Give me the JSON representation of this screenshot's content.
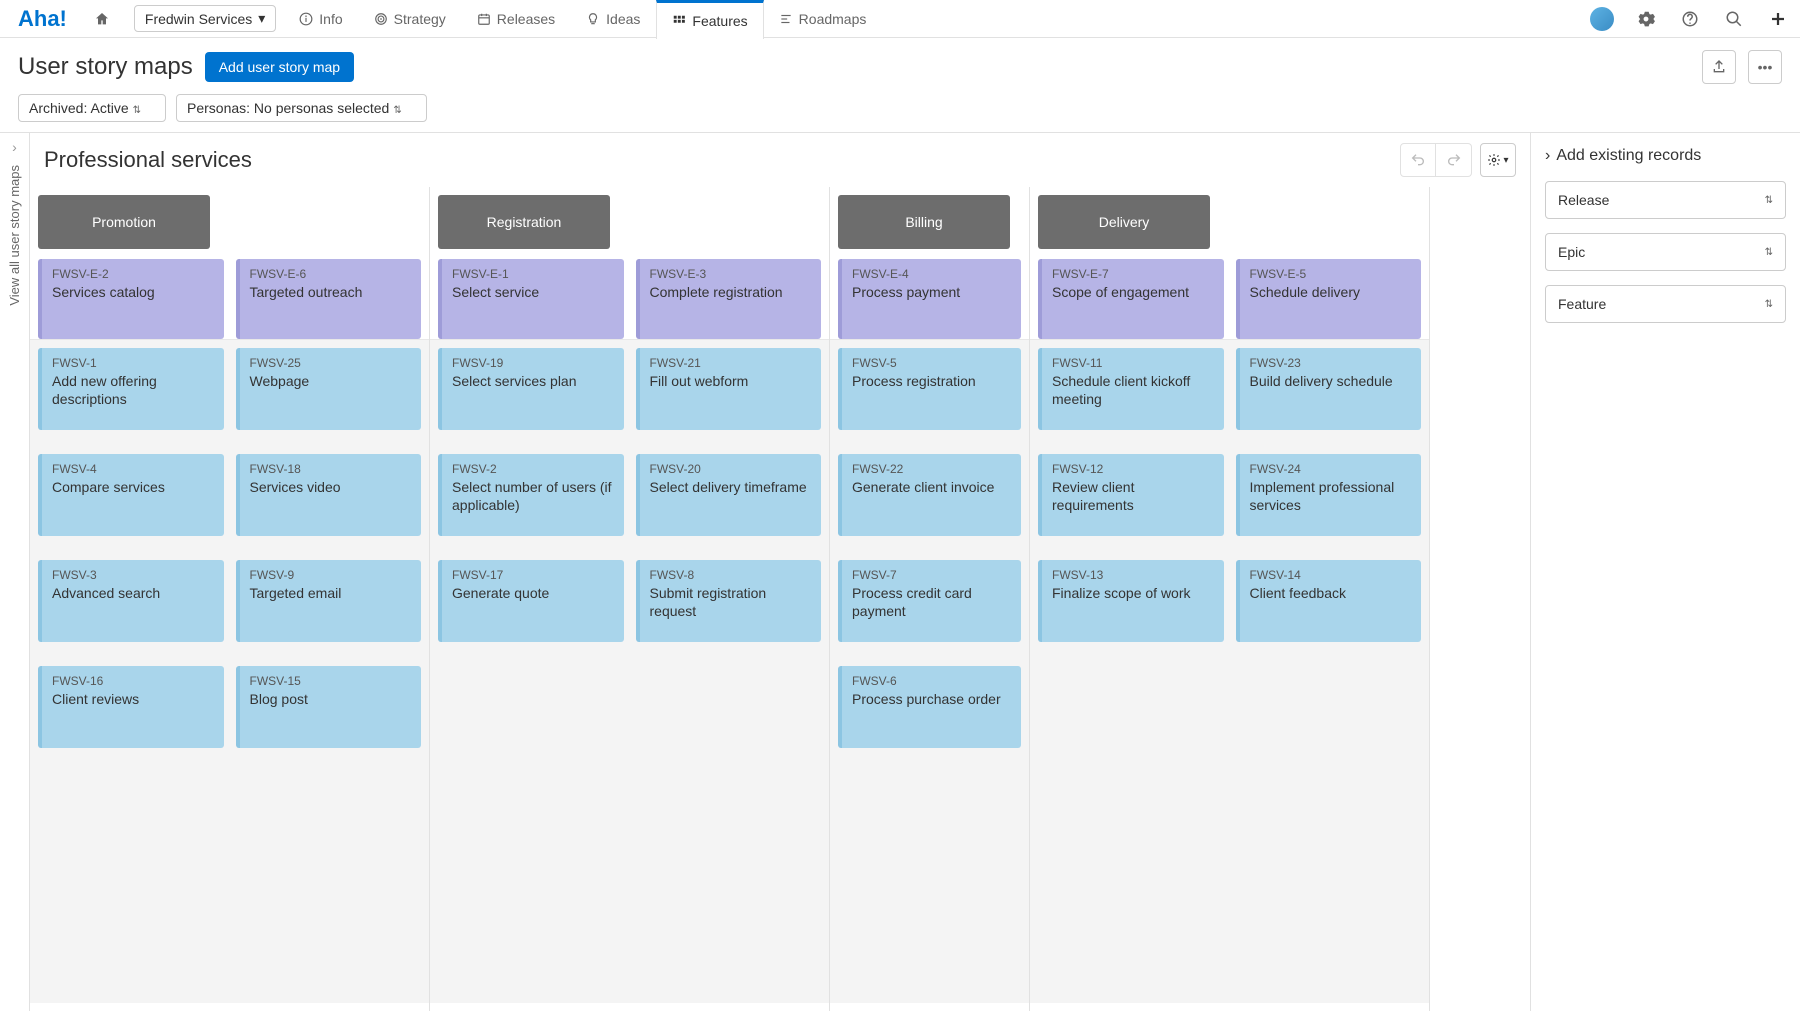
{
  "logo": "Aha!",
  "workspace": "Fredwin Services",
  "nav": {
    "info": "Info",
    "strategy": "Strategy",
    "releases": "Releases",
    "ideas": "Ideas",
    "features": "Features",
    "roadmaps": "Roadmaps"
  },
  "page": {
    "title": "User story maps",
    "add_button": "Add user story map"
  },
  "filters": {
    "archived": "Archived: Active",
    "personas": "Personas: No personas selected"
  },
  "rail_text": "View all user story maps",
  "board_title": "Professional services",
  "side_panel": {
    "title": "Add existing records",
    "release": "Release",
    "epic": "Epic",
    "feature": "Feature"
  },
  "columns": [
    {
      "steps": [
        {
          "label": "Promotion",
          "epic": {
            "ref": "FWSV-E-2",
            "title": "Services catalog"
          },
          "features": [
            {
              "ref": "FWSV-1",
              "title": "Add new offering descriptions"
            },
            {
              "ref": "FWSV-4",
              "title": "Compare services"
            },
            {
              "ref": "FWSV-3",
              "title": "Advanced search"
            },
            {
              "ref": "FWSV-16",
              "title": "Client reviews"
            }
          ]
        },
        {
          "label": "",
          "epic": {
            "ref": "FWSV-E-6",
            "title": "Targeted outreach"
          },
          "features": [
            {
              "ref": "FWSV-25",
              "title": "Webpage"
            },
            {
              "ref": "FWSV-18",
              "title": "Services video"
            },
            {
              "ref": "FWSV-9",
              "title": "Targeted email"
            },
            {
              "ref": "FWSV-15",
              "title": "Blog post"
            }
          ]
        }
      ]
    },
    {
      "steps": [
        {
          "label": "Registration",
          "epic": {
            "ref": "FWSV-E-1",
            "title": "Select service"
          },
          "features": [
            {
              "ref": "FWSV-19",
              "title": "Select services plan"
            },
            {
              "ref": "FWSV-2",
              "title": "Select number of users (if applicable)"
            },
            {
              "ref": "FWSV-17",
              "title": "Generate quote"
            }
          ]
        },
        {
          "label": "",
          "epic": {
            "ref": "FWSV-E-3",
            "title": "Complete registration"
          },
          "features": [
            {
              "ref": "FWSV-21",
              "title": "Fill out webform"
            },
            {
              "ref": "FWSV-20",
              "title": "Select delivery timeframe"
            },
            {
              "ref": "FWSV-8",
              "title": "Submit registration request"
            }
          ]
        }
      ]
    },
    {
      "steps": [
        {
          "label": "Billing",
          "epic": {
            "ref": "FWSV-E-4",
            "title": "Process payment"
          },
          "features": [
            {
              "ref": "FWSV-5",
              "title": "Process registration"
            },
            {
              "ref": "FWSV-22",
              "title": "Generate client invoice"
            },
            {
              "ref": "FWSV-7",
              "title": "Process credit card payment"
            },
            {
              "ref": "FWSV-6",
              "title": "Process purchase order"
            }
          ]
        }
      ]
    },
    {
      "steps": [
        {
          "label": "Delivery",
          "epic": {
            "ref": "FWSV-E-7",
            "title": "Scope of engagement"
          },
          "features": [
            {
              "ref": "FWSV-11",
              "title": "Schedule client kickoff meeting"
            },
            {
              "ref": "FWSV-12",
              "title": "Review client requirements"
            },
            {
              "ref": "FWSV-13",
              "title": "Finalize scope of work"
            }
          ]
        },
        {
          "label": "",
          "epic": {
            "ref": "FWSV-E-5",
            "title": "Schedule delivery"
          },
          "features": [
            {
              "ref": "FWSV-23",
              "title": "Build delivery schedule"
            },
            {
              "ref": "FWSV-24",
              "title": "Implement professional services"
            },
            {
              "ref": "FWSV-14",
              "title": "Client feedback"
            }
          ]
        }
      ]
    }
  ]
}
